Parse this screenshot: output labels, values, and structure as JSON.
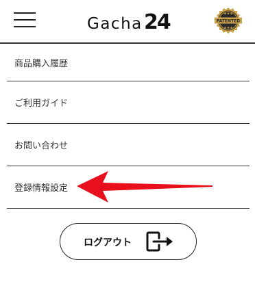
{
  "header": {
    "menu_icon": "hamburger-menu-icon",
    "logo_word": "Gacha",
    "logo_number": "24",
    "badge_text": "PATENTED"
  },
  "menu": {
    "items": [
      {
        "label": "商品購入履歴"
      },
      {
        "label": "ご利用ガイド"
      },
      {
        "label": "お問い合わせ"
      },
      {
        "label": "登録情報設定"
      }
    ]
  },
  "annotation": {
    "arrow_color": "#e8101c",
    "icon": "arrow-left-icon"
  },
  "logout": {
    "label": "ログアウト",
    "icon": "logout-icon"
  },
  "colors": {
    "badge_gold": "#c9a24a",
    "badge_dark": "#2a2a2a",
    "text": "#333333"
  }
}
